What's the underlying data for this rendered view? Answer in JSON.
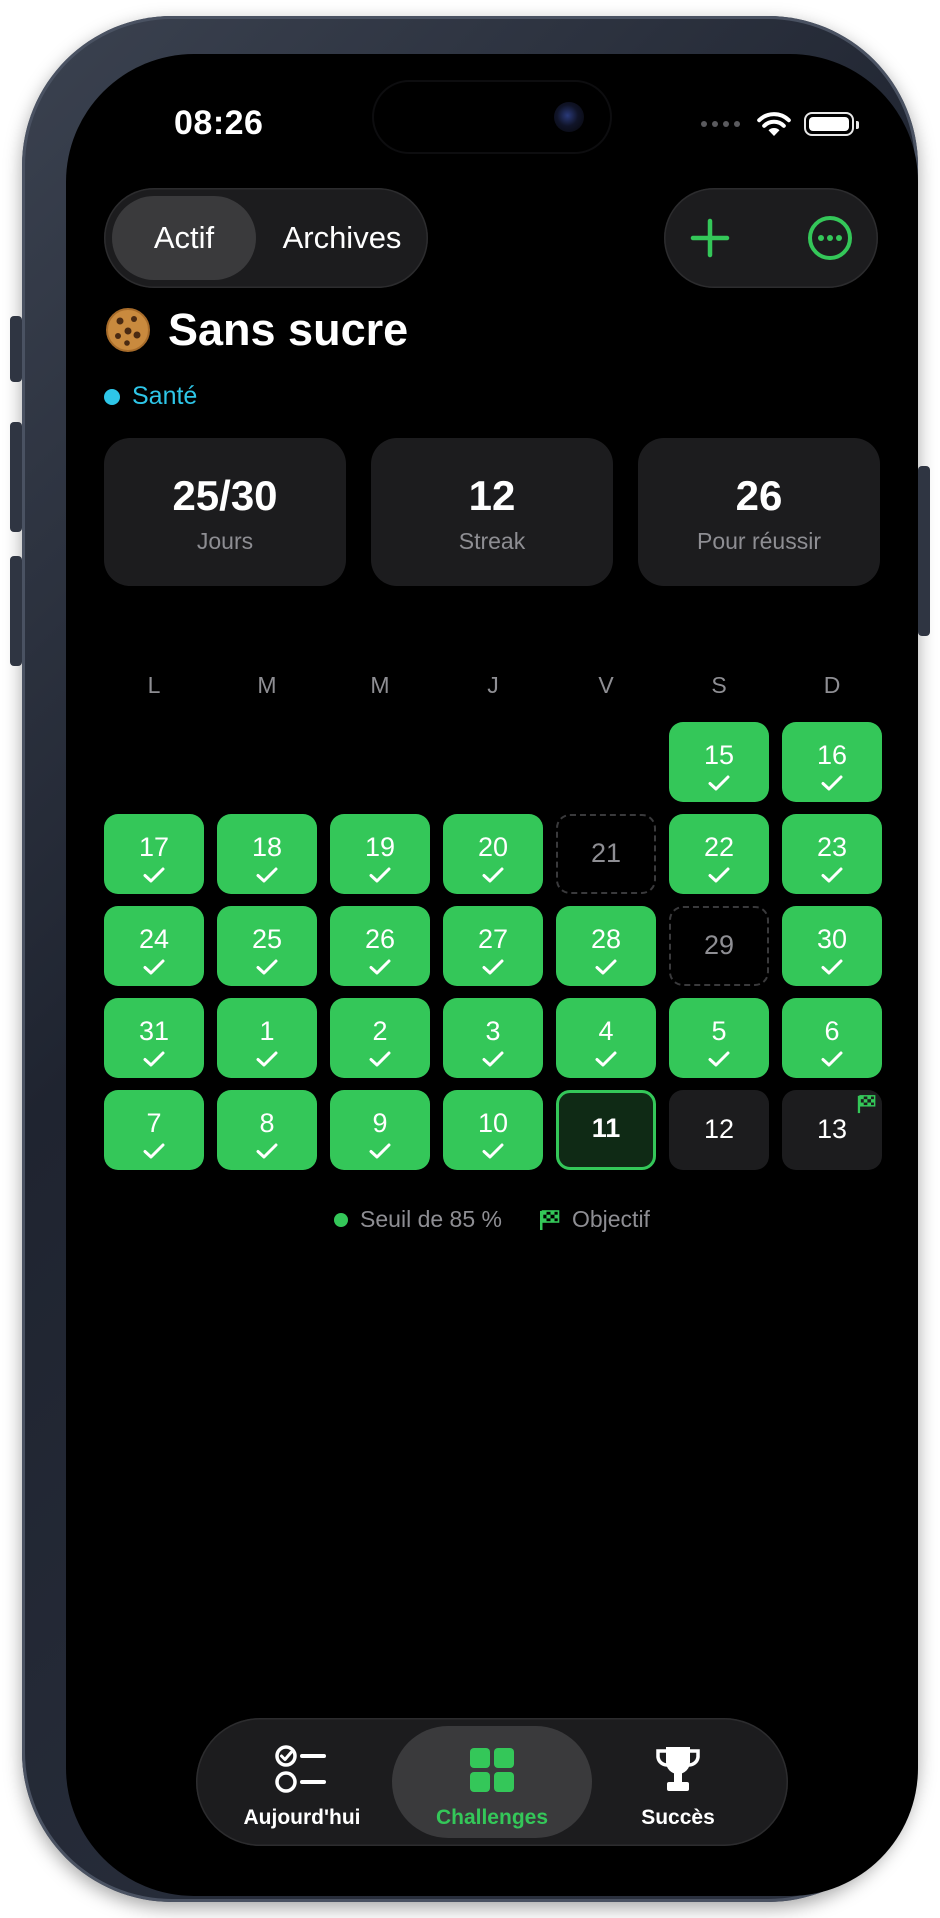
{
  "status_bar": {
    "time": "08:26"
  },
  "segmented": {
    "active_label": "Actif",
    "archives_label": "Archives"
  },
  "challenge": {
    "emoji_icon": "cookie-icon",
    "title": "Sans sucre",
    "category": "Santé",
    "category_color": "#2ec6e8"
  },
  "stats": [
    {
      "value": "25/30",
      "label": "Jours"
    },
    {
      "value": "12",
      "label": "Streak"
    },
    {
      "value": "26",
      "label": "Pour réussir"
    }
  ],
  "weekdays": [
    "L",
    "M",
    "M",
    "J",
    "V",
    "S",
    "D"
  ],
  "calendar": [
    {
      "day": "15",
      "status": "done"
    },
    {
      "day": "16",
      "status": "done"
    },
    {
      "day": "17",
      "status": "done"
    },
    {
      "day": "18",
      "status": "done"
    },
    {
      "day": "19",
      "status": "done"
    },
    {
      "day": "20",
      "status": "done"
    },
    {
      "day": "21",
      "status": "missed"
    },
    {
      "day": "22",
      "status": "done"
    },
    {
      "day": "23",
      "status": "done"
    },
    {
      "day": "24",
      "status": "done"
    },
    {
      "day": "25",
      "status": "done"
    },
    {
      "day": "26",
      "status": "done"
    },
    {
      "day": "27",
      "status": "done"
    },
    {
      "day": "28",
      "status": "done"
    },
    {
      "day": "29",
      "status": "missed"
    },
    {
      "day": "30",
      "status": "done"
    },
    {
      "day": "31",
      "status": "done"
    },
    {
      "day": "1",
      "status": "done"
    },
    {
      "day": "2",
      "status": "done"
    },
    {
      "day": "3",
      "status": "done"
    },
    {
      "day": "4",
      "status": "done"
    },
    {
      "day": "5",
      "status": "done"
    },
    {
      "day": "6",
      "status": "done"
    },
    {
      "day": "7",
      "status": "done"
    },
    {
      "day": "8",
      "status": "done"
    },
    {
      "day": "9",
      "status": "done"
    },
    {
      "day": "10",
      "status": "done"
    },
    {
      "day": "11",
      "status": "today"
    },
    {
      "day": "12",
      "status": "future"
    },
    {
      "day": "13",
      "status": "goal"
    }
  ],
  "legend": {
    "threshold_label": "Seuil de 85 %",
    "goal_label": "Objectif"
  },
  "tabbar": {
    "items": [
      {
        "label": "Aujourd'hui",
        "icon": "checklist-icon"
      },
      {
        "label": "Challenges",
        "icon": "grid-icon"
      },
      {
        "label": "Succès",
        "icon": "trophy-icon"
      }
    ]
  },
  "colors": {
    "accent": "#34c759",
    "background": "#000000",
    "card": "#1c1c1e",
    "secondary_text": "#8e8e93"
  }
}
